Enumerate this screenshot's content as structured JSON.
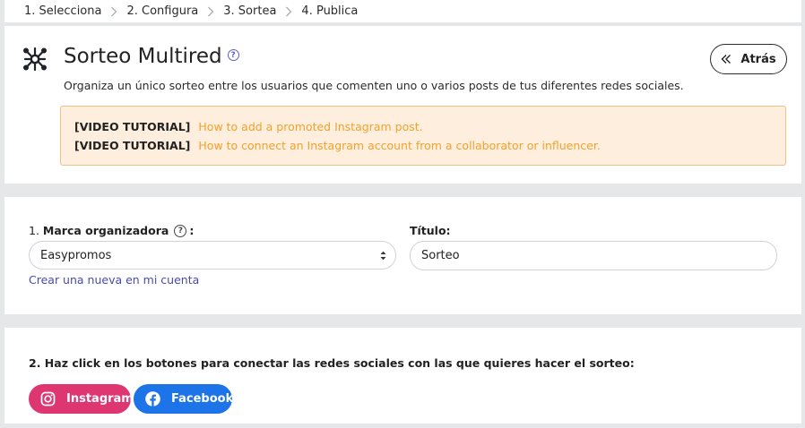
{
  "wizard": {
    "steps": [
      "1. Selecciona",
      "2. Configura",
      "3. Sortea",
      "4. Publica"
    ]
  },
  "header": {
    "logo_icon": "network-icon",
    "title": "Sorteo Multired",
    "help_icon": "question-icon",
    "subtitle": "Organiza un único sorteo entre los usuarios que comenten uno o varios posts de tus diferentes redes sociales.",
    "back_label": "Atrás"
  },
  "tutorials": [
    {
      "tag": "[VIDEO TUTORIAL]",
      "link": "How to add a promoted Instagram post."
    },
    {
      "tag": "[VIDEO TUTORIAL]",
      "link": "How to connect an Instagram account from a collaborator or influencer."
    }
  ],
  "form": {
    "brand_prefix": "1.",
    "brand_label": "Marca organizadora",
    "brand_suffix": ":",
    "brand_value": "Easypromos",
    "create_link": "Crear una nueva en mi cuenta",
    "title_label": "Título:",
    "title_value": "Sorteo"
  },
  "social": {
    "instruction": "2. Haz click en los botones para conectar las redes sociales con las que quieres hacer el sorteo:",
    "instagram_label": "Instagram",
    "facebook_label": "Facebook"
  },
  "colors": {
    "accent": "#5b5fc7",
    "link_orange": "#f2a22c",
    "tutorial_bg": "#fdeedd",
    "instagram": "#de3671",
    "facebook": "#1c74e8"
  }
}
